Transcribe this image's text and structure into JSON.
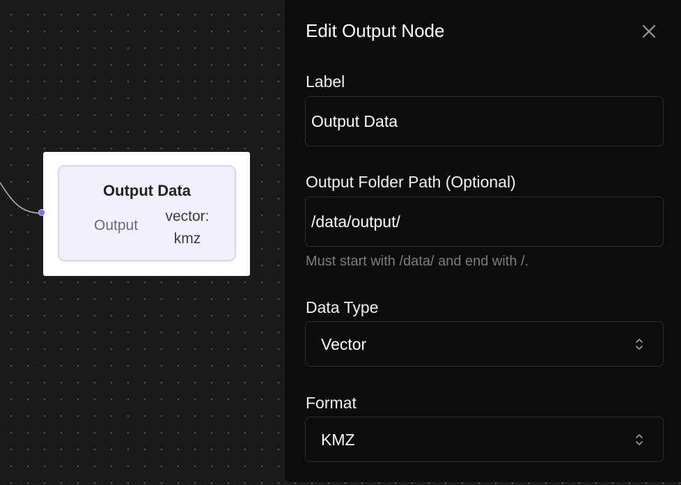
{
  "node": {
    "title": "Output Data",
    "output_label": "Output",
    "format_label": "vector: kmz"
  },
  "panel": {
    "title": "Edit Output Node",
    "close_icon": "close-icon",
    "fields": {
      "label": {
        "label": "Label",
        "value": "Output Data"
      },
      "output_folder_path": {
        "label": "Output Folder Path (Optional)",
        "value": "/data/output/",
        "hint": "Must start with /data/ and end with /."
      },
      "data_type": {
        "label": "Data Type",
        "value": "Vector",
        "icon": "chevron-up-down-icon"
      },
      "format": {
        "label": "Format",
        "value": "KMZ",
        "icon": "chevron-up-down-icon"
      }
    }
  },
  "colors": {
    "canvas_bg": "#1b1b1c",
    "panel_bg": "#0c0c0c",
    "node_accent": "#8b6ce8",
    "node_inner_bg": "#f4effd"
  }
}
